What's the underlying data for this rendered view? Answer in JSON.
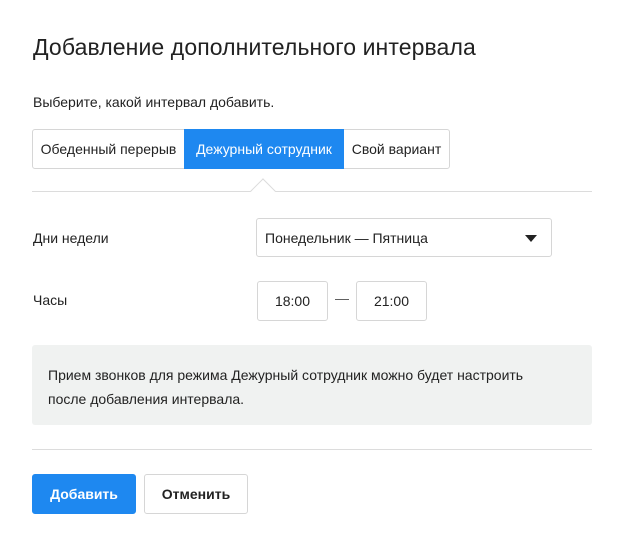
{
  "dialog": {
    "title": "Добавление дополнительного интервала",
    "subtitle": "Выберите, какой интервал добавить."
  },
  "interval_types": [
    {
      "label": "Обеденный перерыв",
      "selected": false
    },
    {
      "label": "Дежурный сотрудник",
      "selected": true
    },
    {
      "label": "Свой вариант",
      "selected": false
    }
  ],
  "form": {
    "days_label": "Дни недели",
    "days_value": "Понедельник — Пятница",
    "hours_label": "Часы",
    "time_from": "18:00",
    "time_separator": "—",
    "time_to": "21:00"
  },
  "info": {
    "line1": "Прием звонков для режима Дежурный сотрудник можно будет настроить",
    "line2": "после добавления интервала."
  },
  "actions": {
    "add_label": "Добавить",
    "cancel_label": "Отменить"
  },
  "colors": {
    "accent": "#1e88f0",
    "info_background": "#f0f2f1",
    "border": "#d6d6d6"
  }
}
